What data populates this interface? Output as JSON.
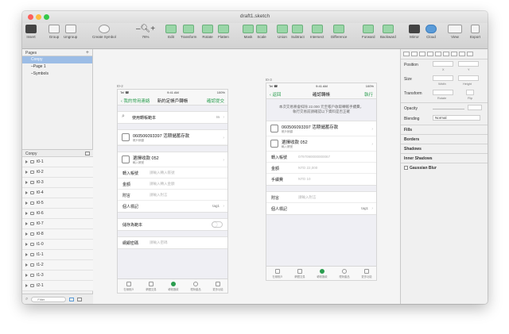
{
  "window": {
    "title": "draft1.sketch"
  },
  "toolbar": {
    "items": [
      "Insert",
      "Group",
      "Ungroup",
      "Create Symbol",
      "Edit",
      "Transform",
      "Rotate",
      "Flatten",
      "Mask",
      "Scale",
      "Union",
      "Subtract",
      "Intersect",
      "Difference",
      "Forward",
      "Backward",
      "Mirror",
      "Cloud",
      "View",
      "Export"
    ],
    "zoom": "76%"
  },
  "pages": {
    "title": "Pages",
    "items": [
      "Conpy",
      "Page 1",
      "Symbols"
    ]
  },
  "layers": {
    "title": "Conpy",
    "items": [
      "t0-1",
      "t0-2",
      "t0-3",
      "t0-4",
      "t0-5",
      "t0-6",
      "t0-7",
      "t0-8",
      "t1-0",
      "t1-1",
      "t1-2",
      "t1-3",
      "t2-1"
    ],
    "filter_placeholder": "Filter"
  },
  "artboards": {
    "a1": {
      "label": "t0-2",
      "status": {
        "carrier": "Tel ☎",
        "time": "9:41 AM",
        "battery": "100%"
      },
      "nav": {
        "back": "我的常用連絡",
        "title": "新約定帳戶轉帳",
        "action": "確認提交"
      },
      "search": {
        "label": "使用轉帳範本",
        "value": "In"
      },
      "account": {
        "number": "060506093397",
        "type": "活期儲蓄存款",
        "sub": "帳戶餘額"
      },
      "transfer": {
        "title": "選擇收款",
        "number": "052",
        "sub": "輸入帳號"
      },
      "fields": [
        {
          "label": "轉入帳號",
          "placeholder": "請輸入轉入帳號"
        },
        {
          "label": "金額",
          "placeholder": "請輸入轉入金額"
        },
        {
          "label": "附言",
          "placeholder": "請輸入附言"
        },
        {
          "label": "個人標記",
          "value": "tag1"
        }
      ],
      "save": {
        "label": "儲存為範本"
      },
      "verify": {
        "label": "網銀密碼",
        "placeholder": "請輸入密碼"
      }
    },
    "a2": {
      "label": "t0-3",
      "status": {
        "carrier": "Tel ☎",
        "time": "9:41 AM",
        "battery": "100%"
      },
      "nav": {
        "back": "返回",
        "title": "確認轉帳",
        "action": "執行"
      },
      "notice": [
        "本次交易將會扣除 22.000 元至帳戶收取轉帳手續費，",
        "執行交易前請確認以下資料是否正確"
      ],
      "account": {
        "number": "060506093397",
        "type": "活期儲蓄存款",
        "sub": "帳戶餘額"
      },
      "transfer": {
        "title": "選擇收款",
        "number": "052",
        "sub": "輸入帳號"
      },
      "fields": [
        {
          "label": "轉入帳號",
          "value": "0797090000000067"
        },
        {
          "label": "金額",
          "value": "NTD 22,000"
        },
        {
          "label": "手續費",
          "value": "NTD 10"
        }
      ],
      "fields2": [
        {
          "label": "附言",
          "value": "請輸入附言"
        },
        {
          "label": "個人標記",
          "value": "tag1"
        }
      ]
    }
  },
  "tabs": [
    "在線帳戶",
    "網銀交易",
    "轉帳匯款",
    "理財產品",
    "更多功能"
  ],
  "inspector": {
    "position": "Position",
    "size": "Size",
    "transform": "Transform",
    "opacity": "Opacity",
    "blending": "Blending",
    "blending_value": "Normal",
    "sub_x": "X",
    "sub_y": "Y",
    "sub_w": "Width",
    "sub_h": "Height",
    "sub_rotate": "Rotate",
    "sub_flip": "Flip",
    "sections": [
      "Fills",
      "Borders",
      "Shadows",
      "Inner Shadows",
      "Gaussian Blur"
    ]
  }
}
